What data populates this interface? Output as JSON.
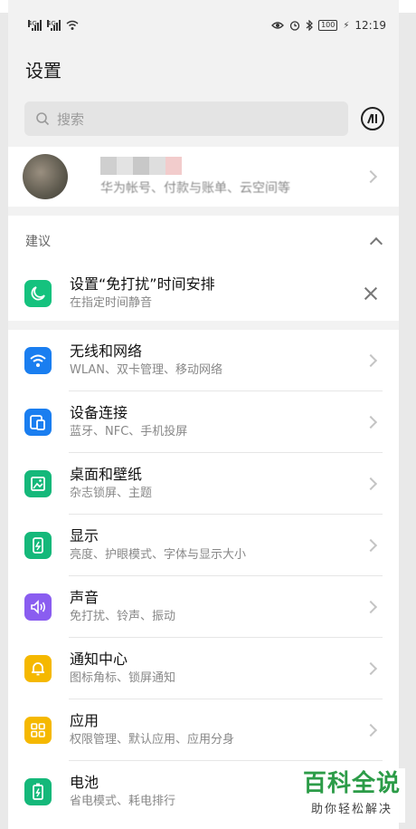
{
  "status_bar": {
    "signal1_tag": "4G",
    "signal2_tag": "4G",
    "battery": "100",
    "time": "12:19"
  },
  "header": {
    "title": "设置"
  },
  "search": {
    "placeholder": "搜索"
  },
  "account": {
    "subtitle": "华为帐号、付款与账单、云空间等"
  },
  "suggestion": {
    "section_title": "建议",
    "item_title": "设置“免打扰”时间安排",
    "item_sub": "在指定时间静音"
  },
  "settings": [
    {
      "title": "无线和网络",
      "sub": "WLAN、双卡管理、移动网络",
      "icon": "wifi-icon",
      "color": "#1a7ef0"
    },
    {
      "title": "设备连接",
      "sub": "蓝牙、NFC、手机投屏",
      "icon": "device-connect-icon",
      "color": "#1a7ef0"
    },
    {
      "title": "桌面和壁纸",
      "sub": "杂志锁屏、主题",
      "icon": "wallpaper-icon",
      "color": "#15b87a"
    },
    {
      "title": "显示",
      "sub": "亮度、护眼模式、字体与显示大小",
      "icon": "display-icon",
      "color": "#15b87a"
    },
    {
      "title": "声音",
      "sub": "免打扰、铃声、振动",
      "icon": "sound-icon",
      "color": "#8a5df0"
    },
    {
      "title": "通知中心",
      "sub": "图标角标、锁屏通知",
      "icon": "bell-icon",
      "color": "#f5b800"
    },
    {
      "title": "应用",
      "sub": "权限管理、默认应用、应用分身",
      "icon": "apps-icon",
      "color": "#f5b800"
    },
    {
      "title": "电池",
      "sub": "省电模式、耗电排行",
      "icon": "battery-icon",
      "color": "#15b87a"
    }
  ],
  "watermark": {
    "top": "百科全说",
    "bottom": "助你轻松解决"
  }
}
